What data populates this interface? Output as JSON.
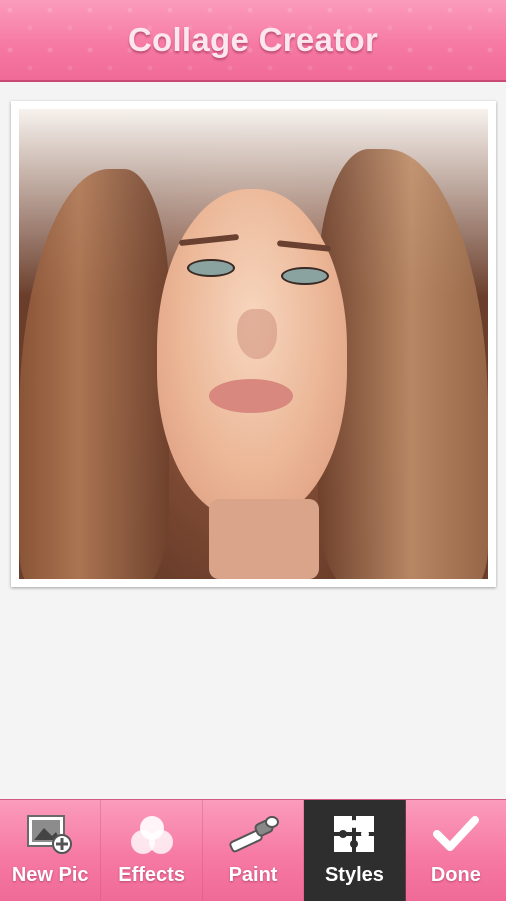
{
  "header": {
    "title": "Collage Creator"
  },
  "toolbar": {
    "items": [
      {
        "label": "New Pic",
        "icon": "new-picture-icon",
        "active": false
      },
      {
        "label": "Effects",
        "icon": "effects-circles-icon",
        "active": false
      },
      {
        "label": "Paint",
        "icon": "paintbrush-icon",
        "active": false
      },
      {
        "label": "Styles",
        "icon": "puzzle-icon",
        "active": true
      },
      {
        "label": "Done",
        "icon": "checkmark-icon",
        "active": false
      }
    ]
  },
  "colors": {
    "header_pink": "#f67aa4",
    "active_tab": "#2e2e2e",
    "background": "#f4f4f4"
  }
}
